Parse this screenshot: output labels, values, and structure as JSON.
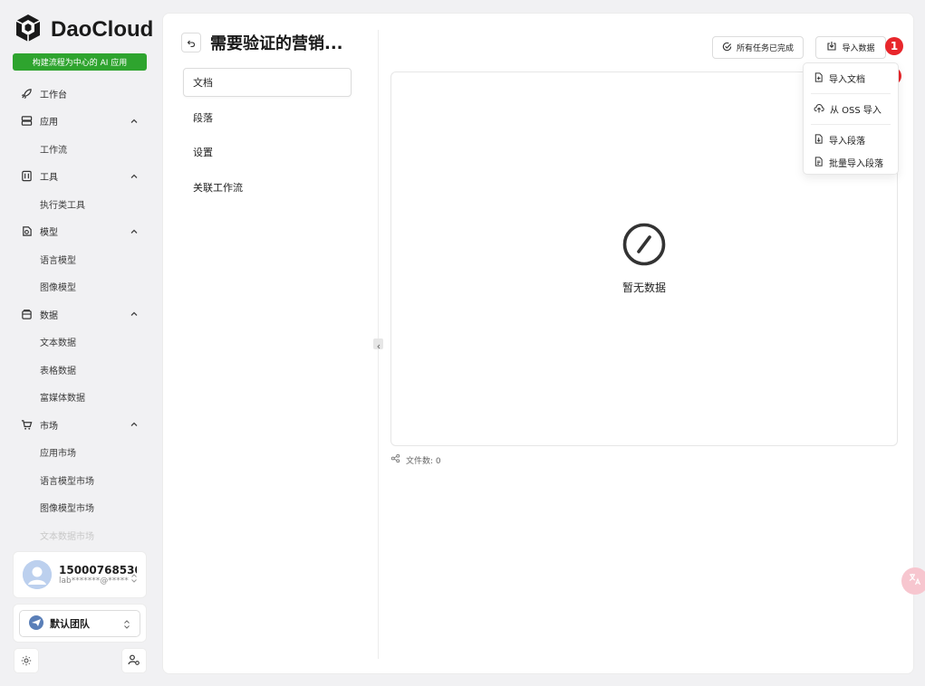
{
  "brand": {
    "name": "DaoCloud",
    "slogan": "构建流程为中心的 AI 应用",
    "accent": "#2ea42e"
  },
  "sidebar": {
    "items": [
      {
        "label": "工作台",
        "icon": "rocket-icon",
        "type": "top"
      },
      {
        "label": "应用",
        "icon": "app-stack-icon",
        "type": "group",
        "expanded": true
      },
      {
        "label": "工作流",
        "type": "sub"
      },
      {
        "label": "工具",
        "icon": "toolbox-icon",
        "type": "group",
        "expanded": true
      },
      {
        "label": "执行类工具",
        "type": "sub"
      },
      {
        "label": "模型",
        "icon": "model-icon",
        "type": "group",
        "expanded": true
      },
      {
        "label": "语言模型",
        "type": "sub"
      },
      {
        "label": "图像模型",
        "type": "sub"
      },
      {
        "label": "数据",
        "icon": "database-icon",
        "type": "group",
        "expanded": true
      },
      {
        "label": "文本数据",
        "type": "sub"
      },
      {
        "label": "表格数据",
        "type": "sub"
      },
      {
        "label": "富媒体数据",
        "type": "sub"
      },
      {
        "label": "市场",
        "icon": "cart-icon",
        "type": "group",
        "expanded": true
      },
      {
        "label": "应用市场",
        "type": "sub"
      },
      {
        "label": "语言模型市场",
        "type": "sub"
      },
      {
        "label": "图像模型市场",
        "type": "sub"
      },
      {
        "label": "文本数据市场",
        "type": "sub"
      }
    ]
  },
  "user": {
    "name": "15000768530",
    "email": "lab*******@*****"
  },
  "team": {
    "name": "默认团队"
  },
  "page": {
    "title": "需要验证的营销..."
  },
  "left_menu": {
    "items": [
      "文档",
      "段落",
      "设置",
      "关联工作流"
    ],
    "active": 0
  },
  "toolbar": {
    "status_label": "所有任务已完成",
    "import_label": "导入数据"
  },
  "steps": {
    "one": "1",
    "two": "2"
  },
  "dropdown": {
    "items": [
      {
        "label": "导入文档",
        "icon": "file-plus-icon"
      },
      {
        "label": "从 OSS 导入",
        "icon": "cloud-upload-icon"
      },
      {
        "label": "导入段落",
        "icon": "file-import-icon"
      },
      {
        "label": "批量导入段落",
        "icon": "file-list-icon"
      }
    ]
  },
  "empty": {
    "text": "暂无数据"
  },
  "footer": {
    "file_count": "文件数: 0"
  },
  "colors": {
    "step_badge": "#e8262b",
    "background": "#f1f1f3"
  }
}
